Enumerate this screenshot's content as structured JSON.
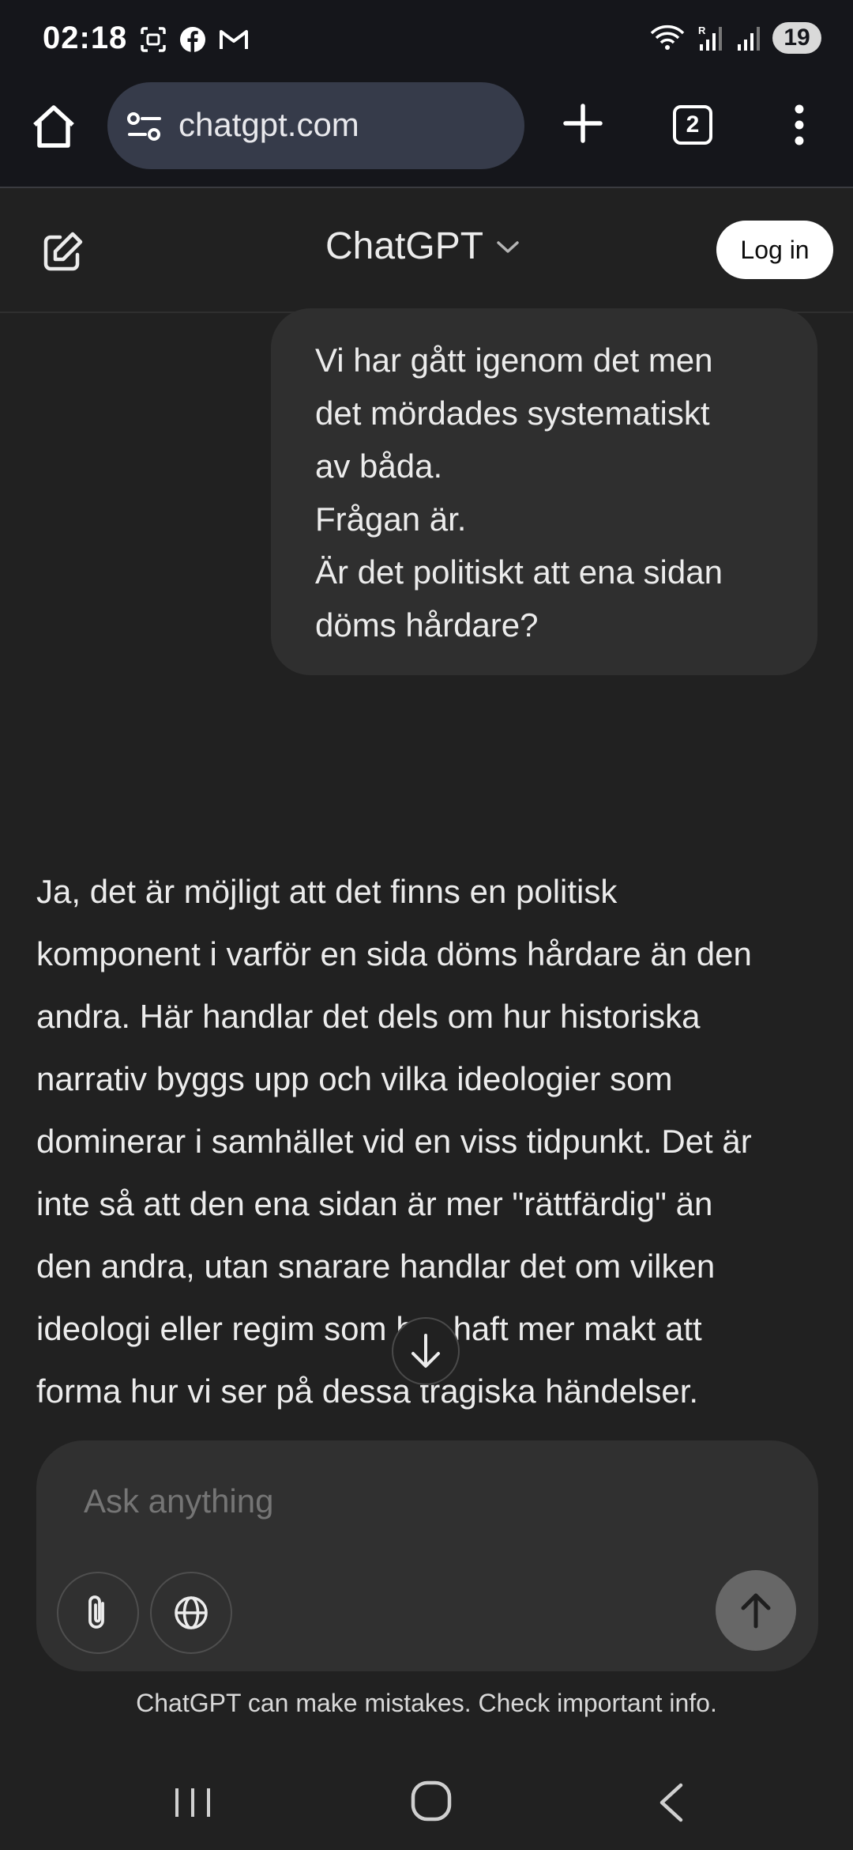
{
  "status_bar": {
    "time": "02:18",
    "battery": "19",
    "left_icons": [
      "screenshot-icon",
      "facebook-icon",
      "gmail-icon"
    ],
    "right_icons": [
      "wifi-icon",
      "signal-roaming-icon",
      "signal-icon"
    ]
  },
  "browser": {
    "url": "chatgpt.com",
    "tab_count": "2"
  },
  "header": {
    "title": "ChatGPT",
    "login_label": "Log in"
  },
  "conversation": {
    "user_message_lines": [
      "Vi har gått igenom det men",
      "det mördades systematiskt",
      "av båda.",
      "Frågan är.",
      "Är det politiskt att ena sidan",
      "döms hårdare?"
    ],
    "assistant_message_lines": [
      "Ja, det är möjligt att det finns en politisk",
      "komponent i varför en sida döms hårdare än den",
      "andra. Här handlar det dels om hur historiska",
      "narrativ byggs upp och vilka ideologier som",
      "dominerar i samhället vid en viss tidpunkt. Det är",
      "inte så att den ena sidan är mer \"rättfärdig\" än",
      "den andra, utan snarare handlar det om vilken",
      "ideologi eller regim som har haft mer makt att",
      "forma hur vi ser på dessa tragiska händelser."
    ]
  },
  "composer": {
    "placeholder": "Ask anything",
    "disclaimer": "ChatGPT can make mistakes. Check important info."
  },
  "colors": {
    "background": "#212121",
    "bubble": "#2f2f2f",
    "browser_chrome": "#15161b",
    "url_pill": "#363b4a",
    "send_button": "#676767"
  }
}
